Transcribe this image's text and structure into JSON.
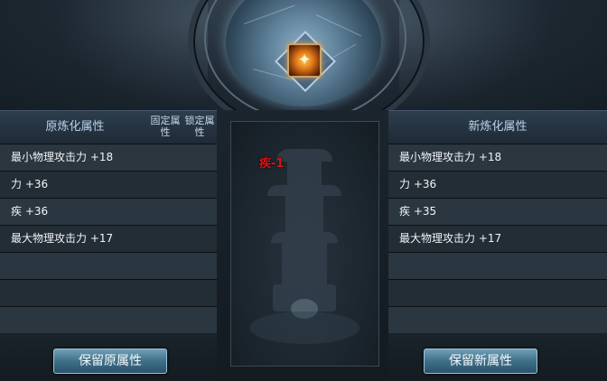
{
  "center": {
    "change_text": "疾-1"
  },
  "left_panel": {
    "title": "原炼化属性",
    "col_fixed": "固定属性",
    "col_lock": "锁定属性",
    "rows": [
      "最小物理攻击力 +18",
      "力 +36",
      "疾 +36",
      "最大物理攻击力 +17",
      "",
      "",
      ""
    ]
  },
  "right_panel": {
    "title": "新炼化属性",
    "rows": [
      "最小物理攻击力 +18",
      "力 +36",
      "疾 +35",
      "最大物理攻击力 +17",
      "",
      "",
      ""
    ]
  },
  "buttons": {
    "keep_original": "保留原属性",
    "keep_new": "保留新属性"
  }
}
